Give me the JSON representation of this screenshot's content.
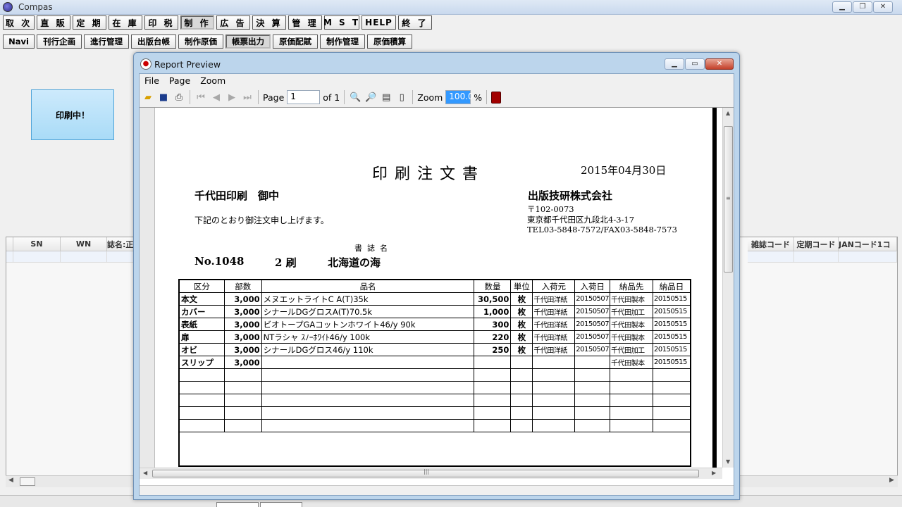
{
  "app": {
    "title": "Compas"
  },
  "menu_row1": [
    "取 次",
    "直 販",
    "定 期",
    "在 庫",
    "印 税",
    "制 作",
    "広 告",
    "決 算",
    "管 理",
    "M S T",
    "HELP",
    "終 了"
  ],
  "menu_row2": [
    "Navi",
    "刊行企画",
    "進行管理",
    "出版台帳",
    "制作原価",
    "帳票出力",
    "原価配賦",
    "制作管理",
    "原価積算"
  ],
  "printing_label": "印刷中！",
  "bg_grid": {
    "left_headers": [
      "SN",
      "WN",
      "誌名:正"
    ],
    "right_headers": [
      "雑誌コード",
      "定期コード",
      "JANコード1コ"
    ]
  },
  "preview": {
    "title": "Report Preview",
    "menu": [
      "File",
      "Page",
      "Zoom"
    ],
    "page_label": "Page",
    "page_value": "1",
    "of_label": "of 1",
    "zoom_label": "Zoom",
    "zoom_value": "100.0",
    "percent": "%"
  },
  "document": {
    "title": "印刷注文書",
    "date": "2015年04月30日",
    "to": "千代田印刷　御中",
    "from": "出版技研株式会社",
    "note": "下記のとおり御注文申し上げます。",
    "postal": "〒102-0073",
    "address": "東京都千代田区九段北4-3-17",
    "tel": "TEL03-5848-7572/FAX03-5848-7573",
    "shoshi_label": "書誌名",
    "number": "No.1048",
    "edition": "2 刷",
    "book_title": "北海道の海",
    "columns": [
      "区分",
      "部数",
      "品名",
      "数量",
      "単位",
      "入荷元",
      "入荷日",
      "納品先",
      "納品日"
    ],
    "rows": [
      [
        "本文",
        "3,000",
        "メヌエットライトC A(T)35k",
        "30,500",
        "枚",
        "千代田洋紙",
        "20150507",
        "千代田製本",
        "20150515"
      ],
      [
        "カバー",
        "3,000",
        "シナールDGグロスA(T)70.5k",
        "1,000",
        "枚",
        "千代田洋紙",
        "20150507",
        "千代田加工",
        "20150515"
      ],
      [
        "表紙",
        "3,000",
        "ビオトープGAコットンホワイト46/y 90k",
        "300",
        "枚",
        "千代田洋紙",
        "20150507",
        "千代田製本",
        "20150515"
      ],
      [
        "扉",
        "3,000",
        "NTラシャ ｽﾉｰﾎﾜｲﾄ46/y 100k",
        "220",
        "枚",
        "千代田洋紙",
        "20150507",
        "千代田製本",
        "20150515"
      ],
      [
        "オビ",
        "3,000",
        "シナールDGグロス46/y 110k",
        "250",
        "枚",
        "千代田洋紙",
        "20150507",
        "千代田加工",
        "20150515"
      ],
      [
        "スリップ",
        "3,000",
        "",
        "",
        "",
        "",
        "",
        "千代田製本",
        "20150515"
      ]
    ]
  }
}
